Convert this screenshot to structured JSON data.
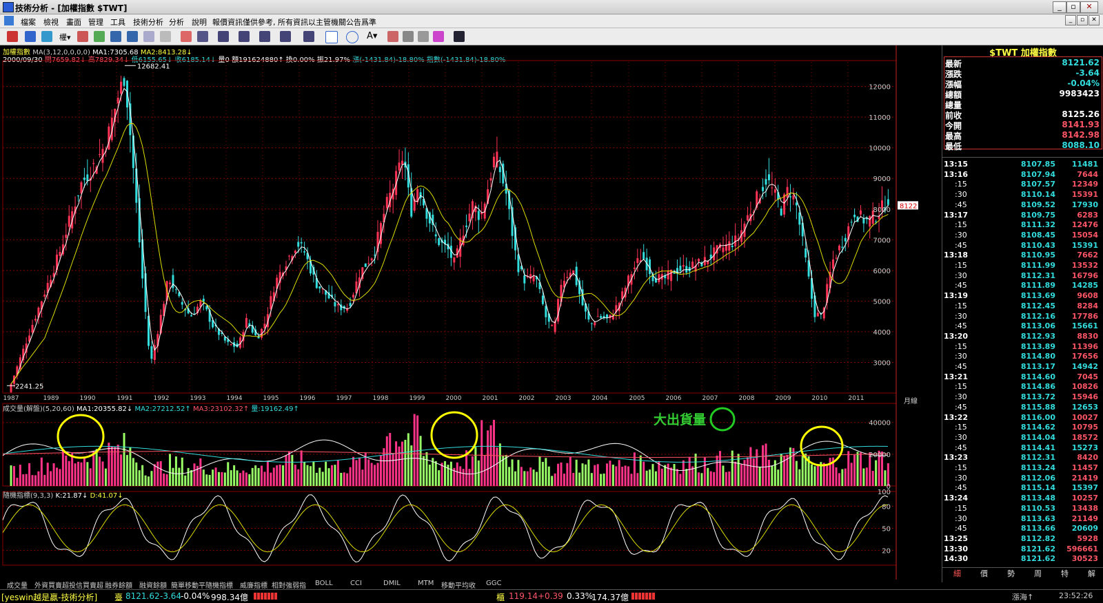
{
  "window": {
    "title": "技術分析 - [加權指數 $TWT]"
  },
  "menu": [
    "檔案",
    "檢視",
    "畫面",
    "管理",
    "工具",
    "技術分析",
    "分析",
    "說明",
    "報價資訊僅供參考, 所有資訊以主管機關公告爲準"
  ],
  "price_header": {
    "line1": [
      "加權指數",
      "MA(3,12,0,0,0,0)",
      "MA1:7305.68",
      "MA2:8413.28↓"
    ],
    "date": "2000/09/30",
    "open": "開7659.82↓",
    "high": "高7829.34↓",
    "low": "低6155.65↓",
    "close": "收6185.14↓",
    "vol": "量0",
    "amt": "額191624880↑",
    "turn": "換0.00%",
    "amp": "振21.97%",
    "chg": "漲(-1431.84)-18.80%",
    "idx": "指數(-1431.84)-18.80%"
  },
  "price_axis": [
    "12000",
    "11000",
    "10000",
    "9000",
    "8000",
    "7000",
    "6000",
    "5000",
    "4000",
    "3000"
  ],
  "price_marks": {
    "high": "12682.41",
    "low": "2241.25",
    "last": "8122"
  },
  "years": [
    "1987",
    "1989",
    "1990",
    "1991",
    "1992",
    "1993",
    "1994",
    "1995",
    "1996",
    "1997",
    "1998",
    "1999",
    "2000",
    "2001",
    "2002",
    "2003",
    "2004",
    "2005",
    "2006",
    "2007",
    "2008",
    "2009",
    "2010",
    "2011"
  ],
  "period_label": "月線",
  "volume_header": [
    "成交量(解盤)(5,20,60)",
    "MA1:20355.82↓",
    "MA2:27212.52↑",
    "MA3:23102.32↑",
    "量:19162.49↑"
  ],
  "volume_axis": [
    "40000",
    "20000",
    "0"
  ],
  "annotation": "大出貨量",
  "kd_header": [
    "隨機指標(9,3,3)",
    "K:21.87↓",
    "D:41.07↓"
  ],
  "kd_axis": [
    "100",
    "80",
    "50",
    "20"
  ],
  "tabs": [
    "成交量",
    "外資買賣超投信買賣超",
    "融券餘額",
    "融資餘額",
    "簡單移動平",
    "隨機指標",
    "威廉指標",
    "相對強弱指",
    "BOLL",
    "CCI",
    "DMIL",
    "MTM",
    "移動平均收",
    "GGC"
  ],
  "quote": {
    "symbol": "$TWT 加權指數",
    "rows": [
      {
        "label": "最新",
        "value": "8121.62",
        "color": "#33dddd"
      },
      {
        "label": "漲跌",
        "value": "-3.64",
        "color": "#33dddd"
      },
      {
        "label": "漲幅",
        "value": "-0.04%",
        "color": "#33dddd"
      },
      {
        "label": "總額",
        "value": "9983423",
        "color": "#ffffff"
      },
      {
        "label": "總量",
        "value": "",
        "color": "#ffffff"
      },
      {
        "label": "前收",
        "value": "8125.26",
        "color": "#ffffff"
      },
      {
        "label": "今開",
        "value": "8141.93",
        "color": "#ff5566"
      },
      {
        "label": "最高",
        "value": "8142.98",
        "color": "#ff5566"
      },
      {
        "label": "最低",
        "value": "8088.10",
        "color": "#33dddd"
      }
    ]
  },
  "ticks": [
    {
      "t": "13:15",
      "p": "8107.85",
      "v": "11481"
    },
    {
      "t": "13:16",
      "p": "8107.94",
      "v": "7644"
    },
    {
      "t": ":15",
      "p": "8107.57",
      "v": "12349"
    },
    {
      "t": ":30",
      "p": "8110.14",
      "v": "15391"
    },
    {
      "t": ":45",
      "p": "8109.52",
      "v": "17930"
    },
    {
      "t": "13:17",
      "p": "8109.75",
      "v": "6283"
    },
    {
      "t": ":15",
      "p": "8111.32",
      "v": "12476"
    },
    {
      "t": ":30",
      "p": "8108.45",
      "v": "15054"
    },
    {
      "t": ":45",
      "p": "8110.43",
      "v": "15391"
    },
    {
      "t": "13:18",
      "p": "8110.95",
      "v": "7662"
    },
    {
      "t": ":15",
      "p": "8111.99",
      "v": "13532"
    },
    {
      "t": ":30",
      "p": "8112.31",
      "v": "16796"
    },
    {
      "t": ":45",
      "p": "8111.89",
      "v": "14285"
    },
    {
      "t": "13:19",
      "p": "8113.69",
      "v": "9608"
    },
    {
      "t": ":15",
      "p": "8112.45",
      "v": "8284"
    },
    {
      "t": ":30",
      "p": "8112.16",
      "v": "17786"
    },
    {
      "t": ":45",
      "p": "8113.06",
      "v": "15661"
    },
    {
      "t": "13:20",
      "p": "8112.93",
      "v": "8830"
    },
    {
      "t": ":15",
      "p": "8113.89",
      "v": "11396"
    },
    {
      "t": ":30",
      "p": "8114.80",
      "v": "17656"
    },
    {
      "t": ":45",
      "p": "8113.17",
      "v": "14942"
    },
    {
      "t": "13:21",
      "p": "8114.60",
      "v": "7045"
    },
    {
      "t": ":15",
      "p": "8114.86",
      "v": "10826"
    },
    {
      "t": ":30",
      "p": "8113.72",
      "v": "15946"
    },
    {
      "t": ":45",
      "p": "8115.88",
      "v": "12653"
    },
    {
      "t": "13:22",
      "p": "8116.00",
      "v": "10027"
    },
    {
      "t": ":15",
      "p": "8114.62",
      "v": "10795"
    },
    {
      "t": ":30",
      "p": "8114.04",
      "v": "18572"
    },
    {
      "t": ":45",
      "p": "8114.41",
      "v": "15273"
    },
    {
      "t": "13:23",
      "p": "8112.31",
      "v": "8420"
    },
    {
      "t": ":15",
      "p": "8113.24",
      "v": "11457"
    },
    {
      "t": ":30",
      "p": "8112.06",
      "v": "21419"
    },
    {
      "t": ":45",
      "p": "8115.14",
      "v": "15397"
    },
    {
      "t": "13:24",
      "p": "8113.48",
      "v": "10257"
    },
    {
      "t": ":15",
      "p": "8110.53",
      "v": "13438"
    },
    {
      "t": ":30",
      "p": "8113.63",
      "v": "21149"
    },
    {
      "t": ":45",
      "p": "8113.66",
      "v": "20609"
    },
    {
      "t": "13:25",
      "p": "8112.82",
      "v": "5928"
    },
    {
      "t": "13:30",
      "p": "8121.62",
      "v": "596661"
    },
    {
      "t": "14:30",
      "p": "8121.62",
      "v": "30523"
    }
  ],
  "right_tabs": [
    "細",
    "價",
    "勢",
    "周",
    "特",
    "解"
  ],
  "status": {
    "brand": "[yeswin越是贏-技術分析]",
    "tw_label": "臺",
    "tw_idx": "8121.62",
    "tw_chg": "-3.64",
    "tw_pct": "-0.04%",
    "tw_amt": "998.34億",
    "otc_label": "櫃",
    "otc_idx": "119.14",
    "otc_chg": "+0.39",
    "otc_pct": "0.33%",
    "otc_amt": "174.37億",
    "mood": "漲海↑",
    "time": "23:52:26"
  }
}
